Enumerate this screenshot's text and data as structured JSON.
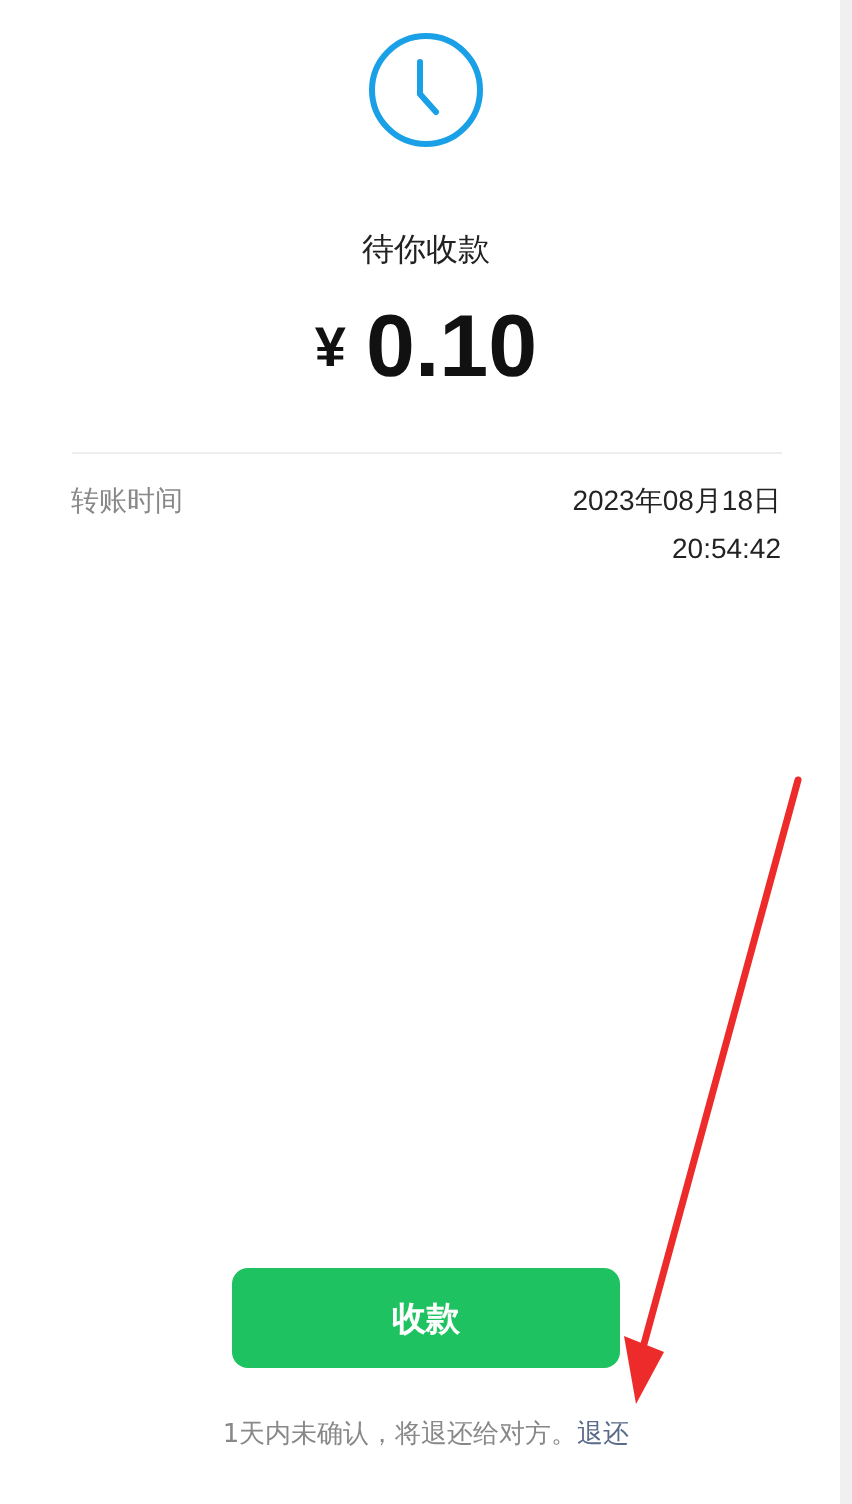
{
  "status": "待你收款",
  "amount": {
    "currency": "¥",
    "value": "0.10"
  },
  "details": [
    {
      "label": "转账时间",
      "lines": [
        "2023年08月18日",
        "20:54:42"
      ]
    }
  ],
  "accept_button": "收款",
  "footer": {
    "text": "1天内未确认，将退还给对方。",
    "link": "退还"
  },
  "annotation": {
    "kind": "arrow"
  }
}
